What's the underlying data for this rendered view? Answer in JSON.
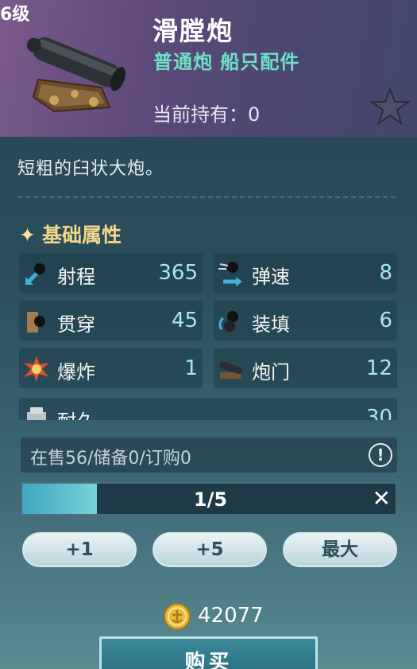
{
  "item": {
    "tier": "6级",
    "name": "滑膛炮",
    "tags": "普通炮 船只配件",
    "holding": "当前持有：0",
    "description": "短粗的臼状大炮。"
  },
  "attributes": {
    "title": "基础属性",
    "items": [
      {
        "label": "射程",
        "value": "365",
        "icon": "range-icon"
      },
      {
        "label": "弹速",
        "value": "8",
        "icon": "shell-speed-icon"
      },
      {
        "label": "贯穿",
        "value": "45",
        "icon": "penetration-icon"
      },
      {
        "label": "装填",
        "value": "6",
        "icon": "reload-icon"
      },
      {
        "label": "爆炸",
        "value": "1",
        "icon": "explosion-icon"
      },
      {
        "label": "炮门",
        "value": "12",
        "icon": "gun-port-icon"
      },
      {
        "label": "耐久",
        "value": "30",
        "icon": "durability-icon"
      }
    ]
  },
  "market": {
    "stock_text": "在售56/储备0/订购0",
    "info_symbol": "!"
  },
  "quantity": {
    "text": "1/5",
    "fraction": 0.2,
    "clear_symbol": "✕"
  },
  "steps": {
    "plus1": "+1",
    "plus5": "+5",
    "max": "最大"
  },
  "price": {
    "amount": "42077",
    "currency_icon": "gold-coin-icon"
  },
  "buy": {
    "label": "购买"
  },
  "colors": {
    "accent_teal": "#6ee0c3",
    "value_blue": "#a6e7f2",
    "section_gold": "#f3d88a"
  }
}
